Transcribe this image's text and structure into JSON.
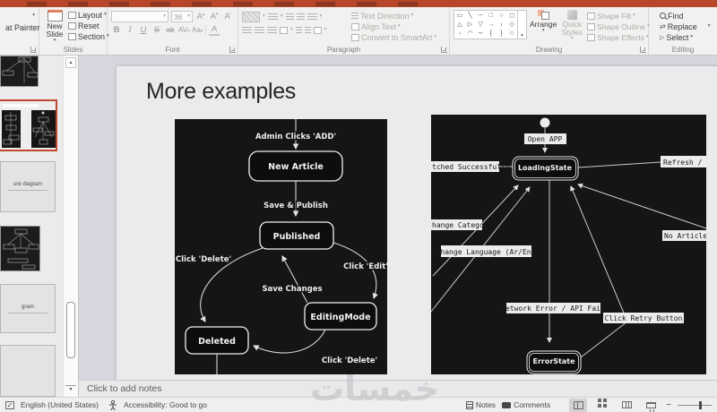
{
  "ribbon": {
    "clipboard": {
      "format_painter": "at Painter"
    },
    "slides": {
      "new_slide": "New Slide",
      "layout": "Layout",
      "reset": "Reset",
      "section": "Section",
      "label": "Slides"
    },
    "font": {
      "size": "36",
      "label": "Font",
      "bold": "B",
      "italic": "I",
      "underline": "U",
      "strike": "S",
      "strike_abc": "ab",
      "char_spacing": "AV",
      "change_case": "Aa",
      "font_color": "A",
      "grow": "A",
      "shrink": "A",
      "clear": "A"
    },
    "paragraph": {
      "text_direction": "Text Direction",
      "align_text": "Align Text",
      "convert_smartart": "Convert to SmartArt",
      "label": "Paragraph"
    },
    "drawing": {
      "arrange": "Arrange",
      "quick_styles": "Quick Styles",
      "shape_fill": "Shape Fill",
      "shape_outline": "Shape Outline",
      "shape_effects": "Shape Effects",
      "label": "Drawing"
    },
    "editing": {
      "find": "Find",
      "replace": "Replace",
      "select": "Select",
      "label": "Editing"
    }
  },
  "thumbnails": {
    "slide3_text": "ure diagram",
    "slide5_text": "gram"
  },
  "slide": {
    "title": "More examples"
  },
  "left_diagram": {
    "admin_clicks": "Admin Clicks 'ADD'",
    "new_article": "New Article",
    "save_publish": "Save & Publish",
    "published": "Published",
    "click_delete_left": "Click 'Delete'",
    "click_edit": "Click 'Edit'",
    "save_changes": "Save Changes",
    "editing_mode": "EditingMode",
    "deleted": "Deleted",
    "click_delete_bottom": "Click 'Delete'"
  },
  "right_diagram": {
    "open_app": "Open APP",
    "loading_state": "LoadingState",
    "fetched": "tched Successfully",
    "refresh": "Refresh /",
    "change_category": "hange Category",
    "change_language": "Change Language (Ar/En)",
    "no_article": "No Article",
    "network_error": "Network Error / API Fail",
    "click_retry": "Click Retry Button",
    "error_state": "ErrorState"
  },
  "notes": {
    "placeholder": "Click to add notes"
  },
  "watermark": {
    "text": "خمسات"
  },
  "statusbar": {
    "language": "English (United States)",
    "accessibility": "Accessibility: Good to go",
    "notes_btn": "Notes",
    "comments_btn": "Comments"
  },
  "colors": {
    "titlebar": "#b7472a",
    "selection_border": "#c0492c",
    "diagram_bg": "#151515"
  }
}
